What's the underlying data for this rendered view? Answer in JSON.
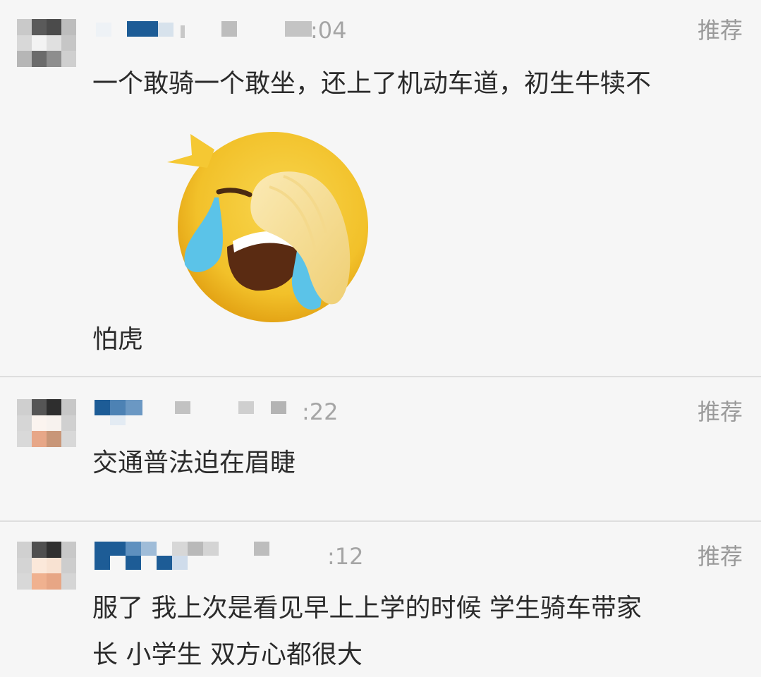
{
  "comments": [
    {
      "time": ":04",
      "recommend_label": "推荐",
      "text_line1": "一个敢骑一个敢坐，还上了机动车道，初生牛犊不",
      "emoji": "crying-laughing-face-icon",
      "text_line2": "怕虎"
    },
    {
      "time": ":22",
      "recommend_label": "推荐",
      "text_line1": "交通普法迫在眉睫"
    },
    {
      "time": ":12",
      "recommend_label": "推荐",
      "text_line1": "服了 我上次是看见早上上学的时候 学生骑车带家",
      "text_line2": "长  小学生  双方心都很大"
    }
  ],
  "colors": {
    "background": "#f6f6f6",
    "divider": "#dedede",
    "text": "#2b2b2b",
    "meta": "#a5a5a5",
    "username_blue": "#1d5c96"
  }
}
